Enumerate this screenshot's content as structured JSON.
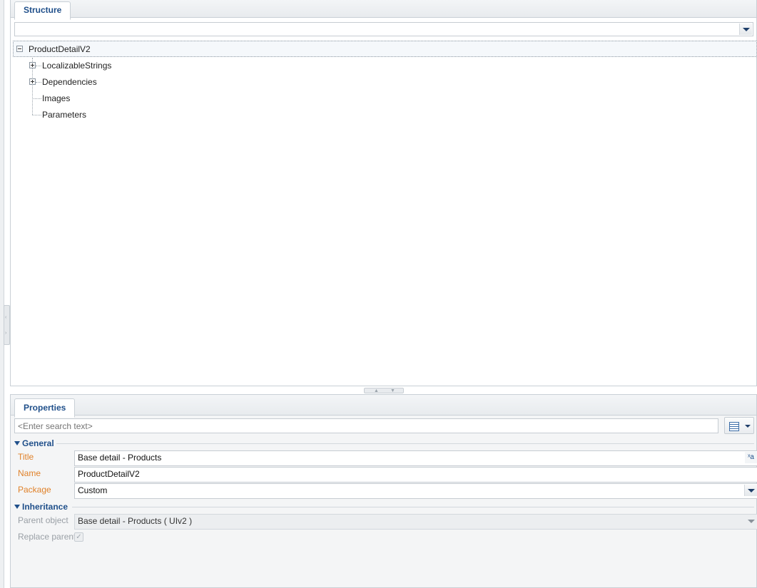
{
  "structure": {
    "tab_label": "Structure",
    "filter_value": "",
    "tree": {
      "root": "ProductDetailV2",
      "children": [
        {
          "label": "LocalizableStrings",
          "expandable": true
        },
        {
          "label": "Dependencies",
          "expandable": true
        },
        {
          "label": "Images",
          "expandable": false
        },
        {
          "label": "Parameters",
          "expandable": false
        }
      ]
    }
  },
  "properties": {
    "tab_label": "Properties",
    "search_placeholder": "<Enter search text>",
    "groups": {
      "general": {
        "title": "General",
        "title_label": "Title",
        "title_value": "Base detail - Products",
        "name_label": "Name",
        "name_value": "ProductDetailV2",
        "package_label": "Package",
        "package_value": "Custom"
      },
      "inheritance": {
        "title": "Inheritance",
        "parent_label": "Parent object",
        "parent_value": "Base detail - Products ( UIv2 )",
        "replace_label": "Replace parent",
        "replace_checked": true
      }
    }
  },
  "icons": {
    "collapse": "minus-box-icon",
    "expand": "plus-box-icon",
    "dropdown": "chevron-down-icon",
    "view": "grid-view-icon",
    "translate": "translate-icon",
    "check": "✓",
    "translate_glyph": "ˣa"
  },
  "colors": {
    "accent": "#1f4f8a",
    "required_label": "#e0822a",
    "disabled_label": "#9aa0a6"
  }
}
